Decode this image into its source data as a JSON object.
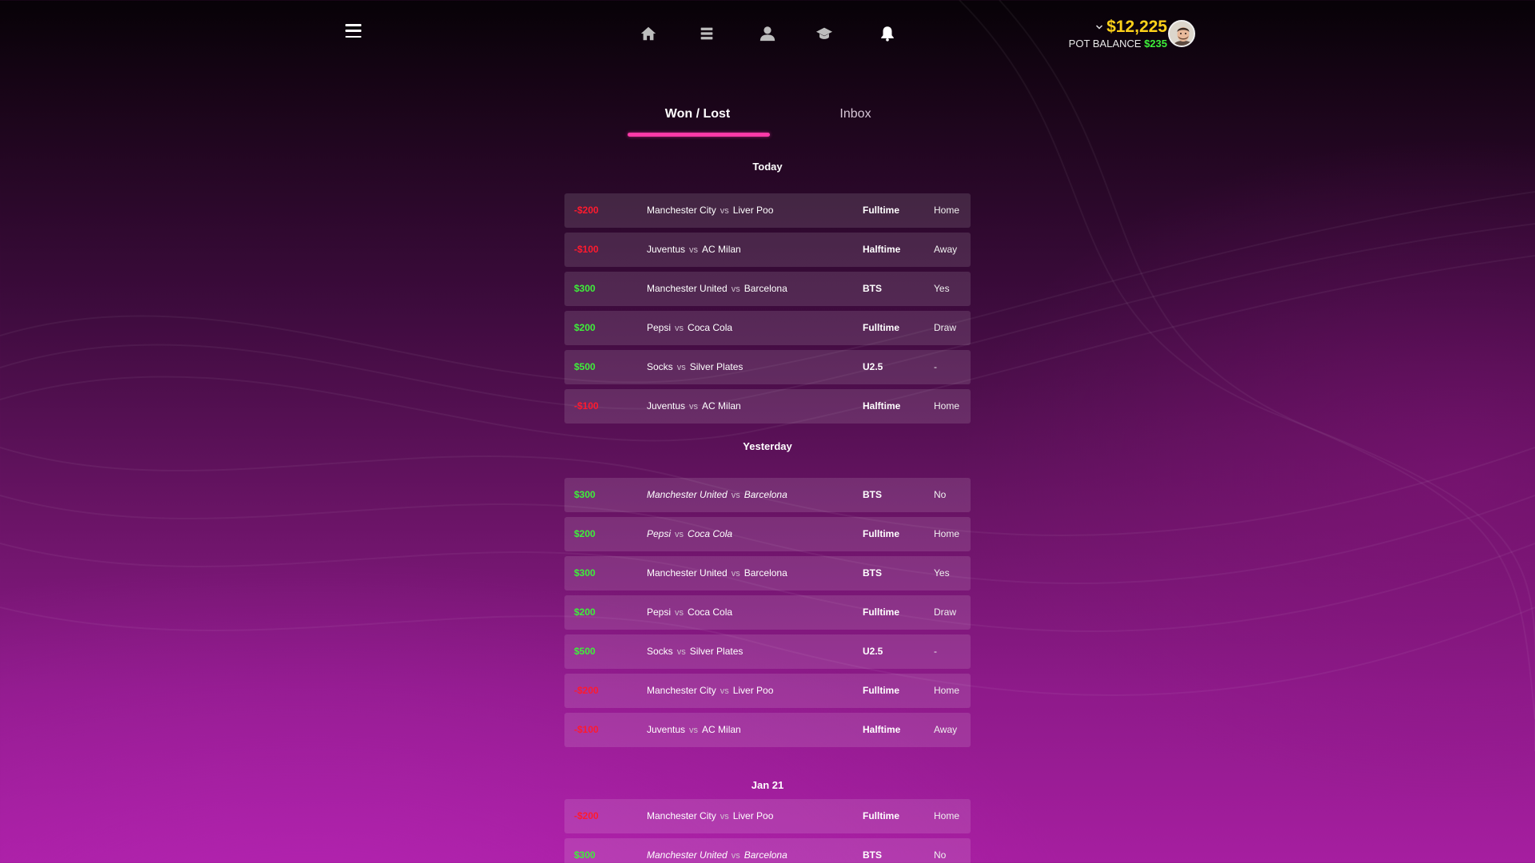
{
  "header": {
    "balance": "$12,225",
    "pot_label": "POT BALANCE",
    "pot_value": "$235"
  },
  "icons": [
    "menu-icon",
    "home-icon",
    "list-icon",
    "user-icon",
    "graduation-cap-icon",
    "bell-icon",
    "chevron-down-icon",
    "avatar"
  ],
  "tabs": [
    {
      "label": "Won / Lost",
      "active": true
    },
    {
      "label": "Inbox",
      "active": false
    }
  ],
  "colors": {
    "win": "#3ef03a",
    "loss": "#ff1a2e",
    "balance": "#ffd21a",
    "tab_underline": "#ff3aa8"
  },
  "sections": [
    {
      "title": "Today",
      "bets": [
        {
          "amount": "-$200",
          "result": "loss",
          "home": "Manchester City",
          "vs": "vs",
          "away": "Liver Poo",
          "market": "Fulltime",
          "pick": "Home",
          "italic": false
        },
        {
          "amount": "-$100",
          "result": "loss",
          "home": "Juventus",
          "vs": "vs",
          "away": "AC Milan",
          "market": "Halftime",
          "pick": "Away",
          "italic": false
        },
        {
          "amount": "$300",
          "result": "win",
          "home": "Manchester United",
          "vs": "vs",
          "away": "Barcelona",
          "market": "BTS",
          "pick": "Yes",
          "italic": false
        },
        {
          "amount": "$200",
          "result": "win",
          "home": "Pepsi",
          "vs": "vs",
          "away": "Coca Cola",
          "market": "Fulltime",
          "pick": "Draw",
          "italic": false
        },
        {
          "amount": "$500",
          "result": "win",
          "home": "Socks",
          "vs": "vs",
          "away": "Silver Plates",
          "market": "U2.5",
          "pick": "-",
          "italic": false
        },
        {
          "amount": "-$100",
          "result": "loss",
          "home": "Juventus",
          "vs": "vs",
          "away": "AC Milan",
          "market": "Halftime",
          "pick": "Home",
          "italic": false
        }
      ]
    },
    {
      "title": "Yesterday",
      "bets": [
        {
          "amount": "$300",
          "result": "win",
          "home": "Manchester United",
          "vs": "vs",
          "away": "Barcelona",
          "market": "BTS",
          "pick": "No",
          "italic": true
        },
        {
          "amount": "$200",
          "result": "win",
          "home": "Pepsi",
          "vs": "vs",
          "away": "Coca Cola",
          "market": "Fulltime",
          "pick": "Home",
          "italic": true
        },
        {
          "amount": "$300",
          "result": "win",
          "home": "Manchester United",
          "vs": "vs",
          "away": "Barcelona",
          "market": "BTS",
          "pick": "Yes",
          "italic": false
        },
        {
          "amount": "$200",
          "result": "win",
          "home": "Pepsi",
          "vs": "vs",
          "away": "Coca Cola",
          "market": "Fulltime",
          "pick": "Draw",
          "italic": false
        },
        {
          "amount": "$500",
          "result": "win",
          "home": "Socks",
          "vs": "vs",
          "away": "Silver Plates",
          "market": "U2.5",
          "pick": "-",
          "italic": false
        },
        {
          "amount": "-$200",
          "result": "loss",
          "home": "Manchester City",
          "vs": "vs",
          "away": "Liver Poo",
          "market": "Fulltime",
          "pick": "Home",
          "italic": false
        },
        {
          "amount": "-$100",
          "result": "loss",
          "home": "Juventus",
          "vs": "vs",
          "away": "AC Milan",
          "market": "Halftime",
          "pick": "Away",
          "italic": false
        }
      ]
    },
    {
      "title": "Jan 21",
      "bets": [
        {
          "amount": "-$200",
          "result": "loss",
          "home": "Manchester City",
          "vs": "vs",
          "away": "Liver Poo",
          "market": "Fulltime",
          "pick": "Home",
          "italic": false
        },
        {
          "amount": "$300",
          "result": "win",
          "home": "Manchester United",
          "vs": "vs",
          "away": "Barcelona",
          "market": "BTS",
          "pick": "No",
          "italic": true
        }
      ]
    }
  ]
}
